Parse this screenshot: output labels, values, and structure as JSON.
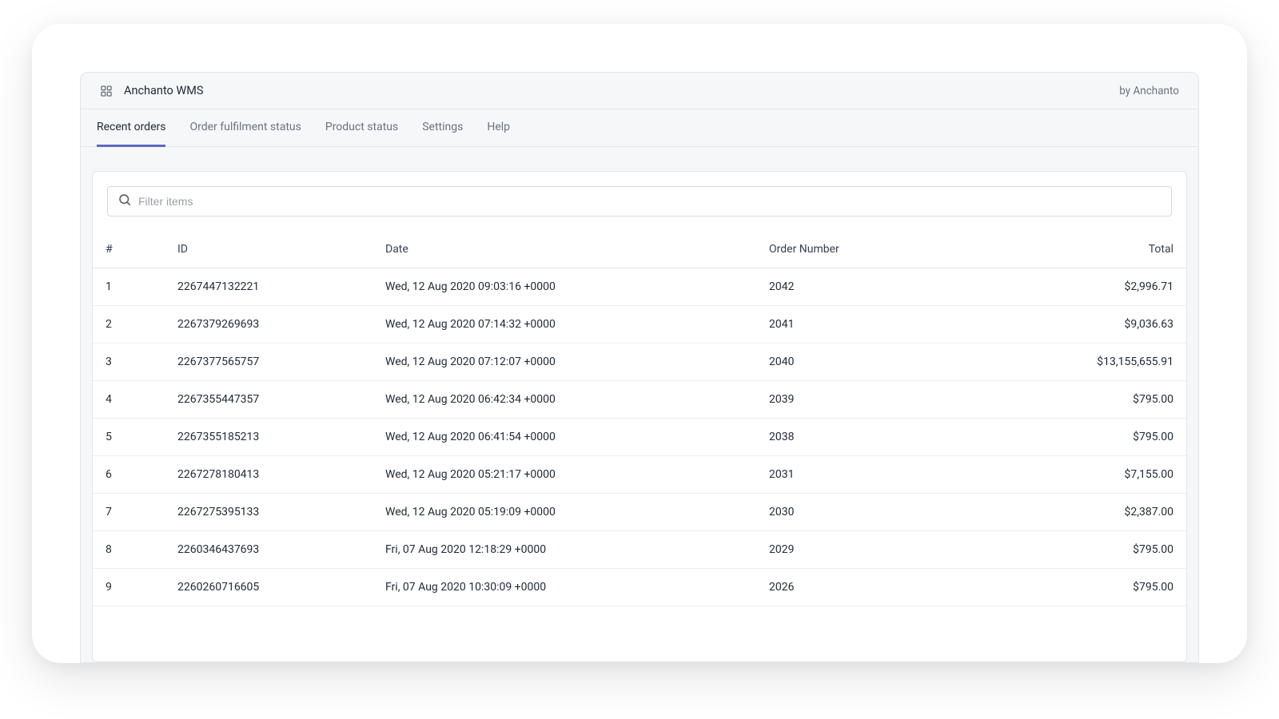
{
  "header": {
    "app_title": "Anchanto WMS",
    "by_line": "by Anchanto"
  },
  "tabs": [
    {
      "label": "Recent orders",
      "active": true
    },
    {
      "label": "Order fulfilment status",
      "active": false
    },
    {
      "label": "Product status",
      "active": false
    },
    {
      "label": "Settings",
      "active": false
    },
    {
      "label": "Help",
      "active": false
    }
  ],
  "filter": {
    "placeholder": "Filter items",
    "value": ""
  },
  "table": {
    "headers": {
      "num": "#",
      "id": "ID",
      "date": "Date",
      "order_number": "Order Number",
      "total": "Total"
    },
    "rows": [
      {
        "num": "1",
        "id": "2267447132221",
        "date": "Wed, 12 Aug 2020 09:03:16 +0000",
        "order_number": "2042",
        "total": "$2,996.71"
      },
      {
        "num": "2",
        "id": "2267379269693",
        "date": "Wed, 12 Aug 2020 07:14:32 +0000",
        "order_number": "2041",
        "total": "$9,036.63"
      },
      {
        "num": "3",
        "id": "2267377565757",
        "date": "Wed, 12 Aug 2020 07:12:07 +0000",
        "order_number": "2040",
        "total": "$13,155,655.91"
      },
      {
        "num": "4",
        "id": "2267355447357",
        "date": "Wed, 12 Aug 2020 06:42:34 +0000",
        "order_number": "2039",
        "total": "$795.00"
      },
      {
        "num": "5",
        "id": "2267355185213",
        "date": "Wed, 12 Aug 2020 06:41:54 +0000",
        "order_number": "2038",
        "total": "$795.00"
      },
      {
        "num": "6",
        "id": "2267278180413",
        "date": "Wed, 12 Aug 2020 05:21:17 +0000",
        "order_number": "2031",
        "total": "$7,155.00"
      },
      {
        "num": "7",
        "id": "2267275395133",
        "date": "Wed, 12 Aug 2020 05:19:09 +0000",
        "order_number": "2030",
        "total": "$2,387.00"
      },
      {
        "num": "8",
        "id": "2260346437693",
        "date": "Fri, 07 Aug 2020 12:18:29 +0000",
        "order_number": "2029",
        "total": "$795.00"
      },
      {
        "num": "9",
        "id": "2260260716605",
        "date": "Fri, 07 Aug 2020 10:30:09 +0000",
        "order_number": "2026",
        "total": "$795.00"
      }
    ]
  }
}
